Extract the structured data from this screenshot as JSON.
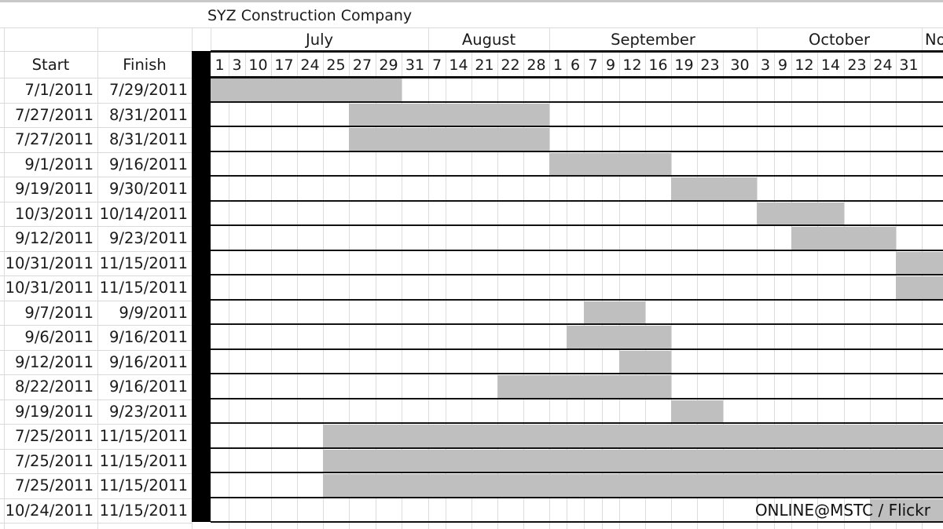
{
  "chart_data": {
    "type": "gantt",
    "title": "SYZ Construction Company",
    "columns": {
      "start": "Start",
      "finish": "Finish"
    },
    "months": [
      {
        "label": "July",
        "first_col": 0,
        "last_col": 8
      },
      {
        "label": "August",
        "first_col": 9,
        "last_col": 13
      },
      {
        "label": "September",
        "first_col": 14,
        "last_col": 22
      },
      {
        "label": "October",
        "first_col": 23,
        "last_col": 29
      },
      {
        "label": "No",
        "first_col": 30,
        "last_col": 30
      }
    ],
    "day_ticks": [
      "1",
      "3",
      "10",
      "17",
      "24",
      "25",
      "27",
      "29",
      "31",
      "7",
      "14",
      "21",
      "22",
      "28",
      "1",
      "6",
      "7",
      "9",
      "12",
      "16",
      "19",
      "23",
      "30",
      "3",
      "9",
      "12",
      "14",
      "23",
      "24",
      "31",
      ""
    ],
    "tasks": [
      {
        "start": "7/1/2011",
        "finish": "7/29/2011",
        "bar_from_tick": 0,
        "bar_to_tick": 8
      },
      {
        "start": "7/27/2011",
        "finish": "8/31/2011",
        "bar_from_tick": 6,
        "bar_to_tick": 14
      },
      {
        "start": "7/27/2011",
        "finish": "8/31/2011",
        "bar_from_tick": 6,
        "bar_to_tick": 14
      },
      {
        "start": "9/1/2011",
        "finish": "9/16/2011",
        "bar_from_tick": 14,
        "bar_to_tick": 20
      },
      {
        "start": "9/19/2011",
        "finish": "9/30/2011",
        "bar_from_tick": 20,
        "bar_to_tick": 23
      },
      {
        "start": "10/3/2011",
        "finish": "10/14/2011",
        "bar_from_tick": 23,
        "bar_to_tick": 27
      },
      {
        "start": "9/12/2011",
        "finish": "9/23/2011",
        "bar_from_tick": 25,
        "bar_to_tick": 29
      },
      {
        "start": "10/31/2011",
        "finish": "11/15/2011",
        "bar_from_tick": 29,
        "bar_to_tick": 31
      },
      {
        "start": "10/31/2011",
        "finish": "11/15/2011",
        "bar_from_tick": 29,
        "bar_to_tick": 31
      },
      {
        "start": "9/7/2011",
        "finish": "9/9/2011",
        "bar_from_tick": 16,
        "bar_to_tick": 19
      },
      {
        "start": "9/6/2011",
        "finish": "9/16/2011",
        "bar_from_tick": 15,
        "bar_to_tick": 20
      },
      {
        "start": "9/12/2011",
        "finish": "9/16/2011",
        "bar_from_tick": 18,
        "bar_to_tick": 20
      },
      {
        "start": "8/22/2011",
        "finish": "9/16/2011",
        "bar_from_tick": 12,
        "bar_to_tick": 20
      },
      {
        "start": "9/19/2011",
        "finish": "9/23/2011",
        "bar_from_tick": 20,
        "bar_to_tick": 22
      },
      {
        "start": "7/25/2011",
        "finish": "11/15/2011",
        "bar_from_tick": 5,
        "bar_to_tick": 31
      },
      {
        "start": "7/25/2011",
        "finish": "11/15/2011",
        "bar_from_tick": 5,
        "bar_to_tick": 31
      },
      {
        "start": "7/25/2011",
        "finish": "11/15/2011",
        "bar_from_tick": 5,
        "bar_to_tick": 31
      },
      {
        "start": "10/24/2011",
        "finish": "11/15/2011",
        "bar_from_tick": 28,
        "bar_to_tick": 31
      }
    ],
    "bar_color": "#bfbfbf"
  },
  "watermark": "ONLINE@MSTC / Flickr"
}
